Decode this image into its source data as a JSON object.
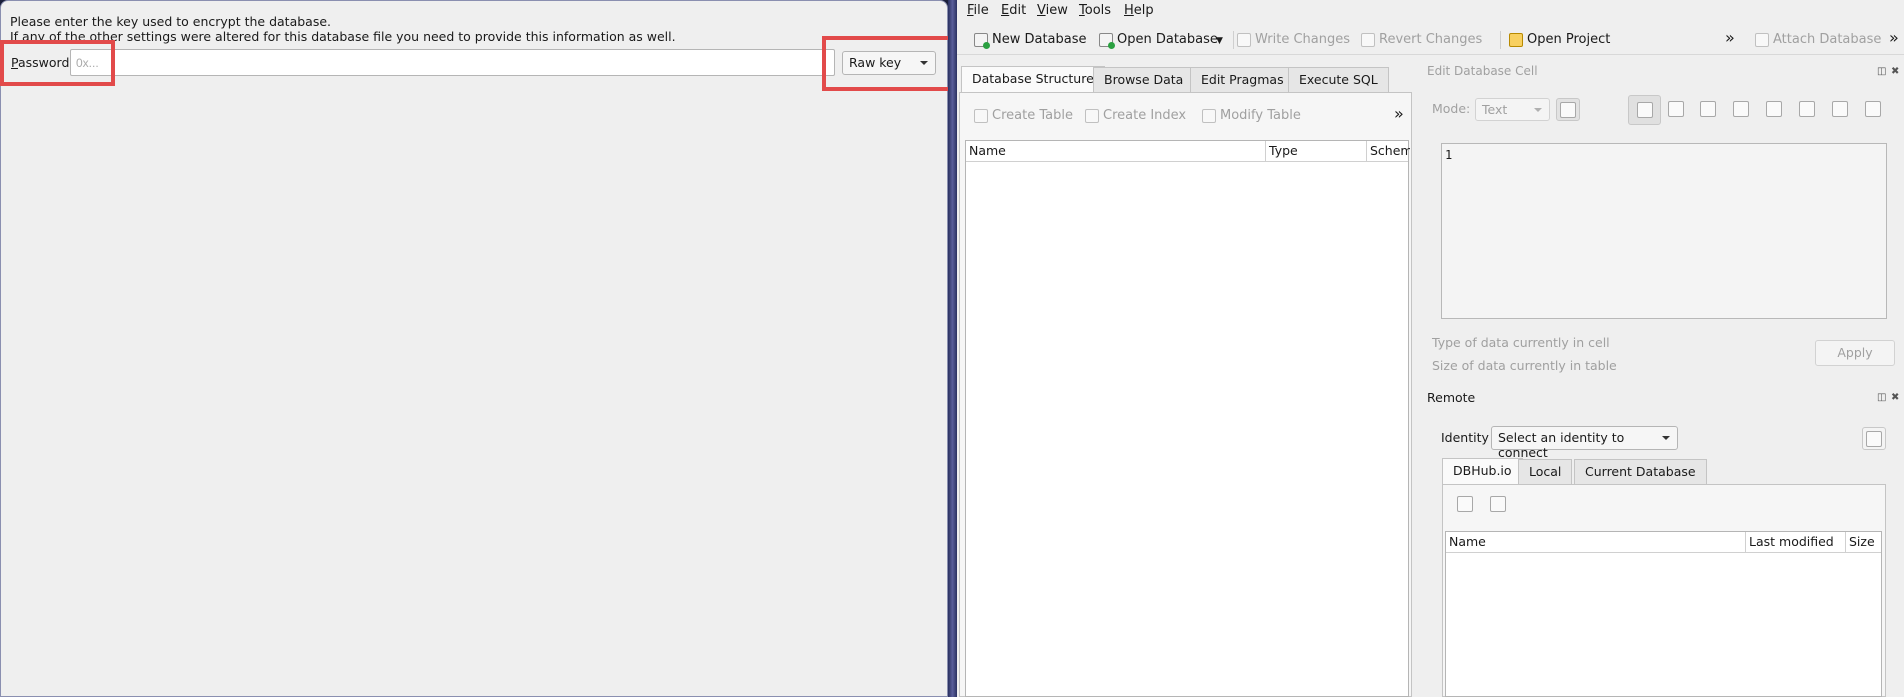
{
  "dialog": {
    "message_line1": "Please enter the key used to encrypt the database.",
    "message_line2": "If any of the other settings were altered for this database file you need to provide this information as well.",
    "password_label_mnemonic": "P",
    "password_label_rest": "assword",
    "password_placeholder": "0x...",
    "password_value": "",
    "key_type": "Raw key",
    "highlight_color": "#e24a4a"
  },
  "menubar": {
    "file": "File",
    "file_mn": "F",
    "file_rest": "ile",
    "edit": "Edit",
    "edit_mn": "E",
    "edit_rest": "dit",
    "view": "View",
    "view_mn": "V",
    "view_rest": "iew",
    "tools": "Tools",
    "tools_mn": "T",
    "tools_rest": "ools",
    "help": "Help",
    "help_mn": "H",
    "help_rest": "elp"
  },
  "toolbar": {
    "new_database": "New Database",
    "open_database": "Open Database",
    "write_changes": "Write Changes",
    "revert_changes": "Revert Changes",
    "open_project": "Open Project",
    "attach_database": "Attach Database",
    "overflow": "»"
  },
  "main_tabs": [
    "Database Structure",
    "Browse Data",
    "Edit Pragmas",
    "Execute SQL"
  ],
  "structure": {
    "create_table": "Create Table",
    "create_index": "Create Index",
    "modify_table": "Modify Table",
    "overflow": "»",
    "columns": [
      "Name",
      "Type",
      "Schem"
    ]
  },
  "edit_cell": {
    "title": "Edit Database Cell",
    "mode_label": "Mode:",
    "mode_value": "Text",
    "cell_value": "1",
    "type_info": "Type of data currently in cell",
    "size_info": "Size of data currently in table",
    "apply": "Apply"
  },
  "remote": {
    "title": "Remote",
    "identity_label": "Identity",
    "identity_value": "Select an identity to connect",
    "tabs": [
      "DBHub.io",
      "Local",
      "Current Database"
    ],
    "columns": [
      "Name",
      "Last modified",
      "Size"
    ]
  }
}
